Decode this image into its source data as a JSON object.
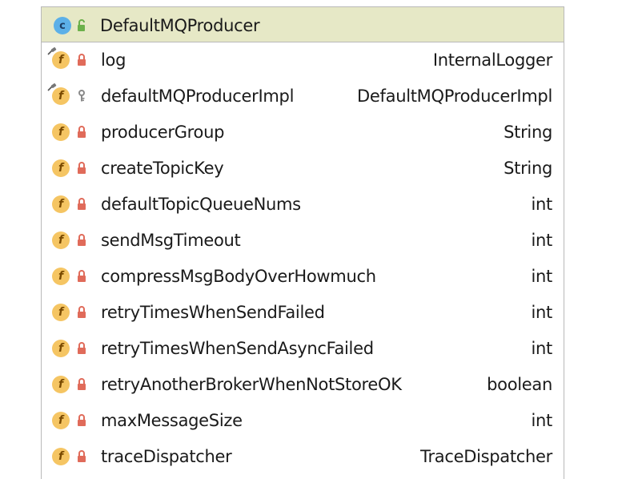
{
  "header": {
    "class_icon_letter": "c",
    "title": "DefaultMQProducer"
  },
  "colors": {
    "header_bg": "#e6e8c6",
    "class_icon": "#5cb0e8",
    "field_icon": "#f5c563",
    "private_lock": "#e06b5a",
    "public_icon": "#6bb04a",
    "package_key": "#8a8a8a"
  },
  "fields": [
    {
      "icon_letter": "f",
      "access": "private",
      "access_icon": "lock-icon",
      "static": true,
      "name": "log",
      "type": "InternalLogger"
    },
    {
      "icon_letter": "f",
      "access": "package",
      "access_icon": "key-icon",
      "static": true,
      "name": "defaultMQProducerImpl",
      "type": "DefaultMQProducerImpl"
    },
    {
      "icon_letter": "f",
      "access": "private",
      "access_icon": "lock-icon",
      "static": false,
      "name": "producerGroup",
      "type": "String"
    },
    {
      "icon_letter": "f",
      "access": "private",
      "access_icon": "lock-icon",
      "static": false,
      "name": "createTopicKey",
      "type": "String"
    },
    {
      "icon_letter": "f",
      "access": "private",
      "access_icon": "lock-icon",
      "static": false,
      "name": "defaultTopicQueueNums",
      "type": "int"
    },
    {
      "icon_letter": "f",
      "access": "private",
      "access_icon": "lock-icon",
      "static": false,
      "name": "sendMsgTimeout",
      "type": "int"
    },
    {
      "icon_letter": "f",
      "access": "private",
      "access_icon": "lock-icon",
      "static": false,
      "name": "compressMsgBodyOverHowmuch",
      "type": "int"
    },
    {
      "icon_letter": "f",
      "access": "private",
      "access_icon": "lock-icon",
      "static": false,
      "name": "retryTimesWhenSendFailed",
      "type": "int"
    },
    {
      "icon_letter": "f",
      "access": "private",
      "access_icon": "lock-icon",
      "static": false,
      "name": "retryTimesWhenSendAsyncFailed",
      "type": "int"
    },
    {
      "icon_letter": "f",
      "access": "private",
      "access_icon": "lock-icon",
      "static": false,
      "name": "retryAnotherBrokerWhenNotStoreOK",
      "type": "boolean"
    },
    {
      "icon_letter": "f",
      "access": "private",
      "access_icon": "lock-icon",
      "static": false,
      "name": "maxMessageSize",
      "type": "int"
    },
    {
      "icon_letter": "f",
      "access": "private",
      "access_icon": "lock-icon",
      "static": false,
      "name": "traceDispatcher",
      "type": "TraceDispatcher"
    }
  ]
}
